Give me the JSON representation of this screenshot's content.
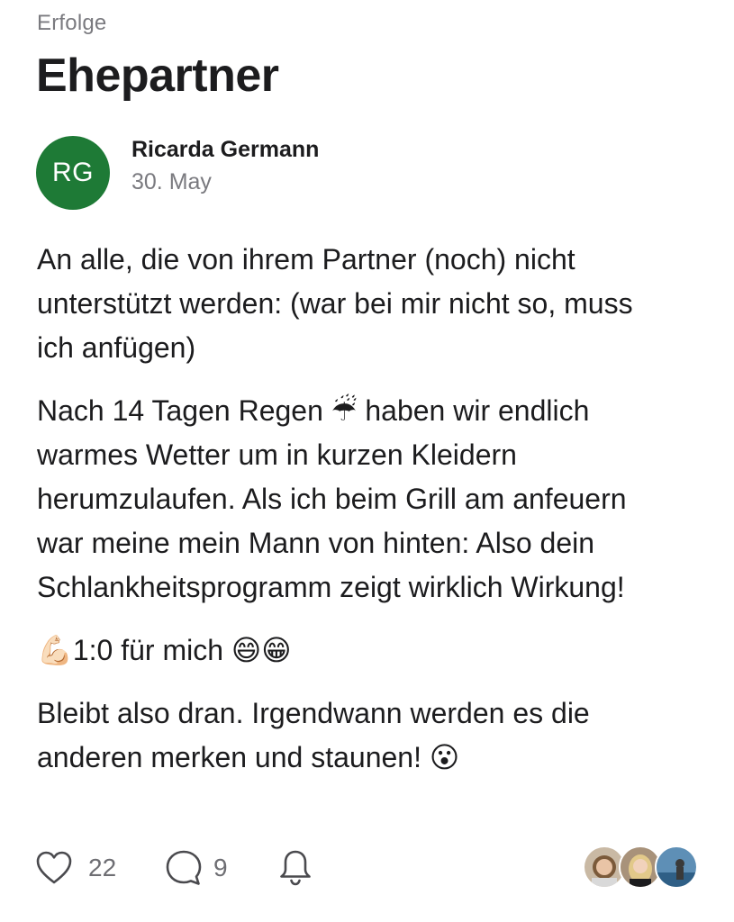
{
  "post": {
    "category": "Erfolge",
    "title": "Ehepartner",
    "author": {
      "initials": "RG",
      "name": "Ricarda Germann",
      "date": "30. May",
      "avatar_color": "#1e7a36"
    },
    "paragraphs": [
      "An alle, die von ihrem Partner (noch) nicht\nunterstützt werden: (war bei mir nicht so, muss\nich anfügen)",
      "Nach 14 Tagen Regen ☔ haben wir endlich\nwarmes Wetter um in kurzen Kleidern\nherumzulaufen. Als ich beim Grill am anfeuern\nwar meine mein Mann von hinten: Also dein\nSchlankheitsprogramm zeigt wirklich Wirkung!",
      "💪🏻1:0 für mich 😄😁",
      "Bleibt also dran. Irgendwann werden es die\nanderen merken und staunen! 😮"
    ]
  },
  "footer": {
    "likes": "22",
    "comments": "9",
    "icons": [
      "heart-icon",
      "comment-icon",
      "bell-icon"
    ],
    "participant_avatars": 3
  }
}
